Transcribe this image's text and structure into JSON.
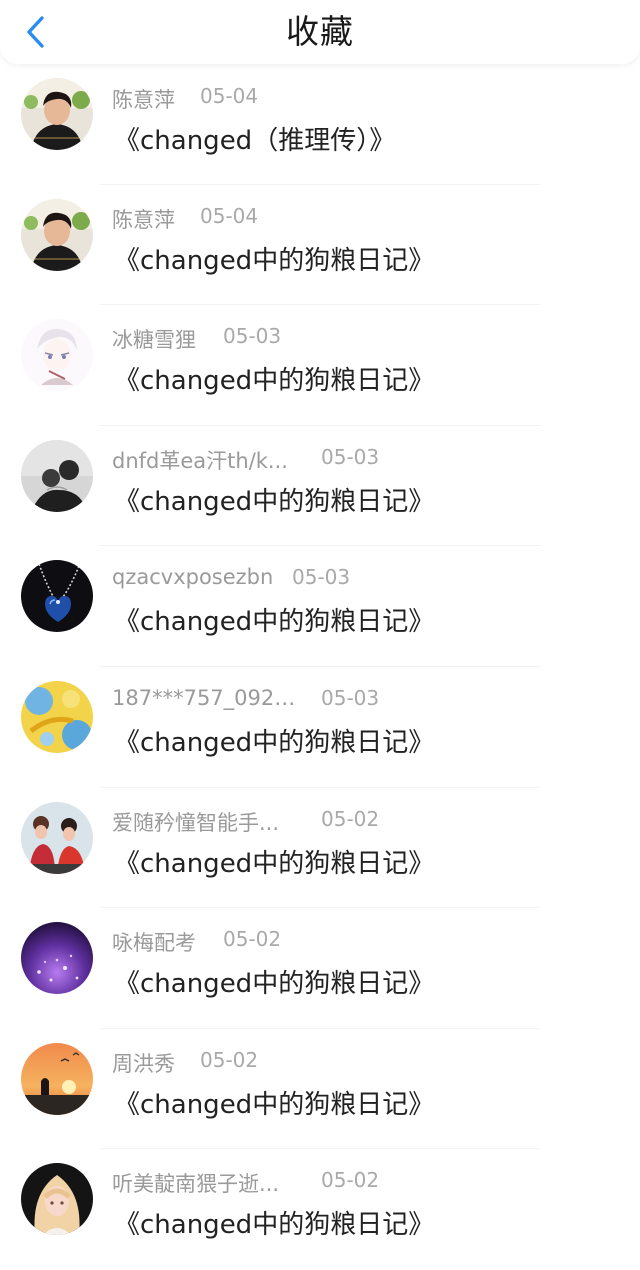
{
  "header": {
    "title": "收藏"
  },
  "colors": {
    "back_arrow": "#2a8bf2",
    "meta_text": "#9a9a9a",
    "title_text": "#222222"
  },
  "items": [
    {
      "name": "陈意萍",
      "date": "05-04",
      "title": "《changed（推理传）》",
      "avatar": "person-portrait"
    },
    {
      "name": "陈意萍",
      "date": "05-04",
      "title": "《changed中的狗粮日记》",
      "avatar": "person-portrait"
    },
    {
      "name": "冰糖雪狸",
      "date": "05-03",
      "title": "《changed中的狗粮日记》",
      "avatar": "anime-sketch"
    },
    {
      "name": "dnfd革ea汗th/k...",
      "date": "05-03",
      "title": "《changed中的狗粮日记》",
      "avatar": "monochrome-couple"
    },
    {
      "name": "qzacvxposezbn",
      "date": "05-03",
      "title": "《changed中的狗粮日记》",
      "avatar": "heart-pendant"
    },
    {
      "name": "187***757_0921...",
      "date": "05-03",
      "title": "《changed中的狗粮日记》",
      "avatar": "golden-abstract"
    },
    {
      "name": "爱随矜憧智能手...",
      "date": "05-02",
      "title": "《changed中的狗粮日记》",
      "avatar": "two-girls"
    },
    {
      "name": "咏梅配考",
      "date": "05-02",
      "title": "《changed中的狗粮日记》",
      "avatar": "purple-glitter"
    },
    {
      "name": "周洪秀",
      "date": "05-02",
      "title": "《changed中的狗粮日记》",
      "avatar": "sunset-silhouette"
    },
    {
      "name": "听美靛南猥子逝...",
      "date": "05-02",
      "title": "《changed中的狗粮日记》",
      "avatar": "blonde-girl"
    }
  ]
}
